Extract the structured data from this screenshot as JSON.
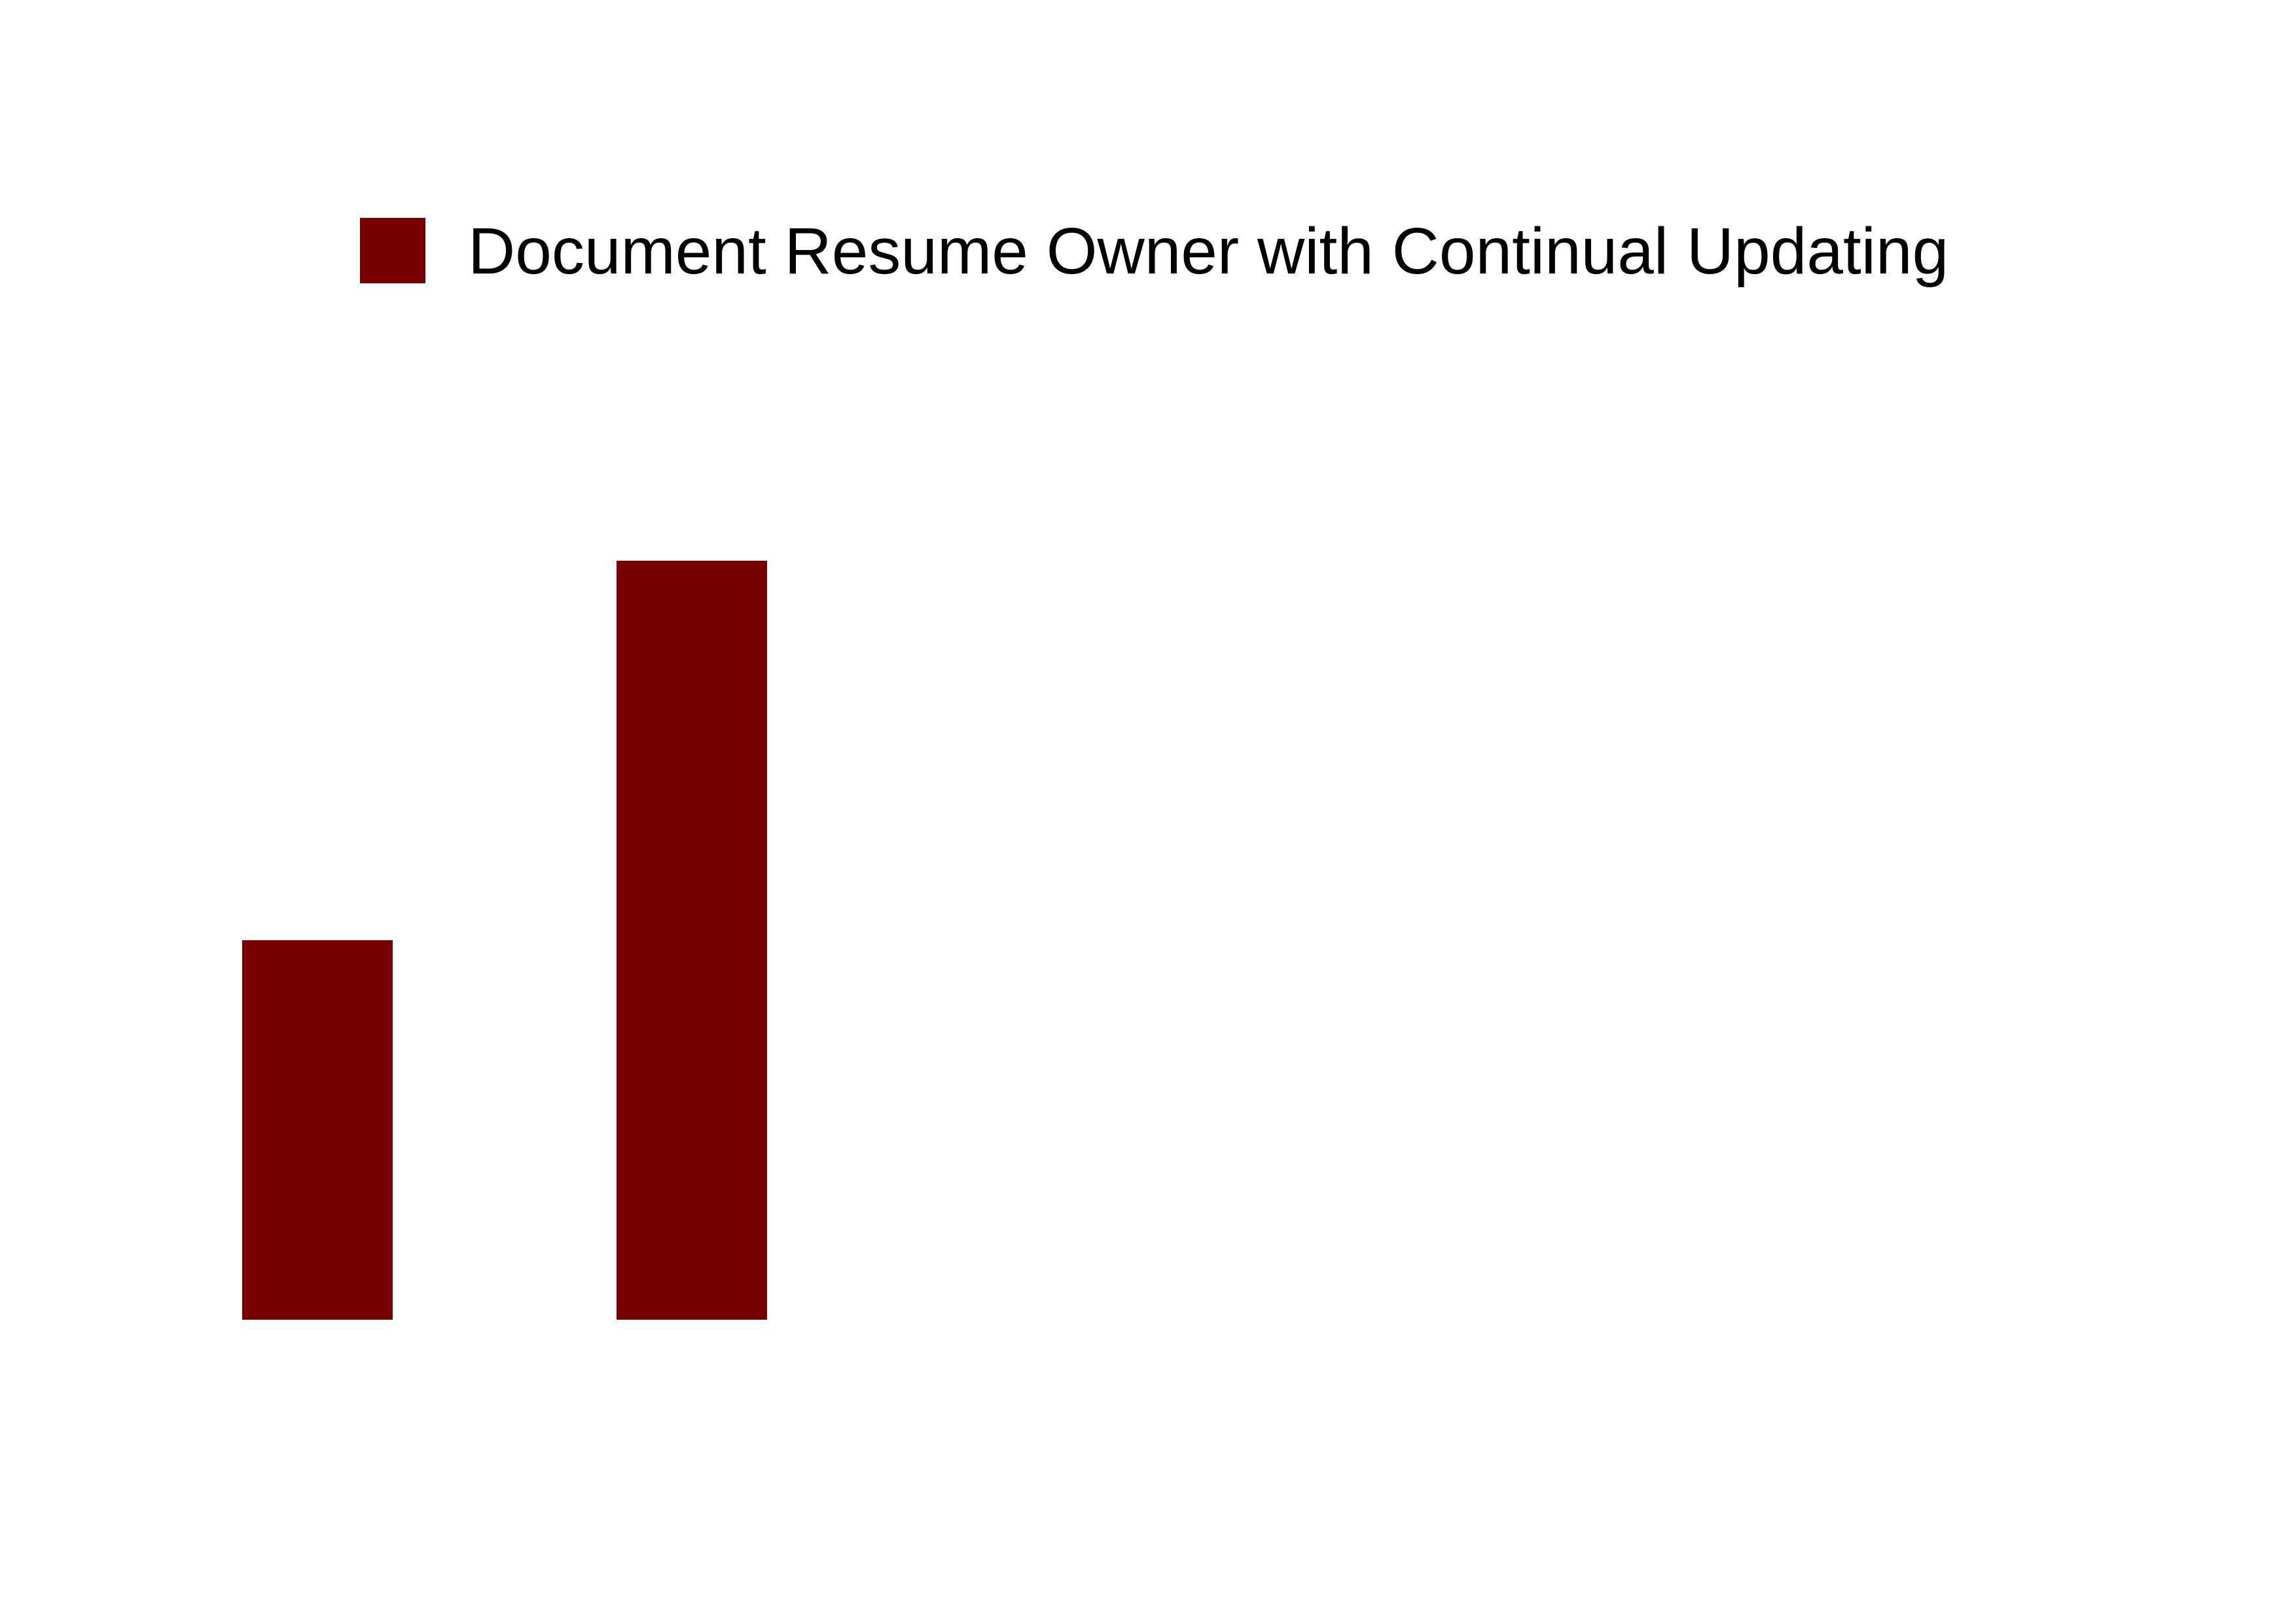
{
  "chart_data": {
    "type": "bar",
    "title": "",
    "xlabel": "",
    "ylabel": "",
    "categories": [
      "",
      ""
    ],
    "ylim": [
      0,
      100
    ],
    "series": [
      {
        "name": "Document Resume Owner with Continual Updating",
        "values": [
          20,
          40
        ],
        "color": "#780000"
      }
    ],
    "legend": {
      "position": "top",
      "label": "Document Resume Owner with Continual Updating"
    },
    "grid": false
  }
}
